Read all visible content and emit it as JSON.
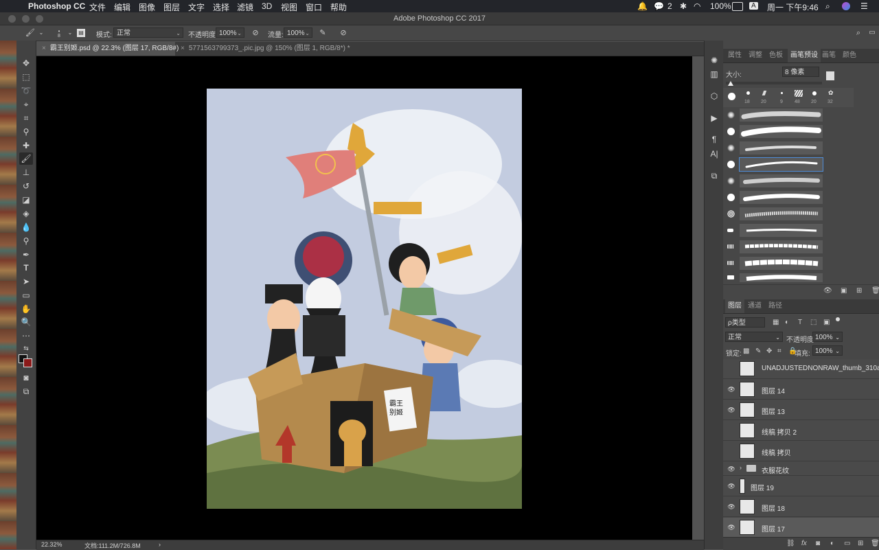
{
  "menubar": {
    "app_name": "Photoshop CC",
    "menus": [
      "文件",
      "编辑",
      "图像",
      "图层",
      "文字",
      "选择",
      "滤镜",
      "3D",
      "视图",
      "窗口",
      "帮助"
    ],
    "wechat_badge": "2",
    "battery": "100%",
    "input_method": "A",
    "clock": "周一 下午9:46"
  },
  "window": {
    "title": "Adobe Photoshop CC 2017"
  },
  "options": {
    "brush_size": "8",
    "mode_label": "模式:",
    "mode_value": "正常",
    "opacity_label": "不透明度:",
    "opacity_value": "100%",
    "flow_label": "流量:",
    "flow_value": "100%"
  },
  "doc_tabs": [
    {
      "label": "霸王别姬.psd @ 22.3% (图层 17, RGB/8#)",
      "active": true
    },
    {
      "label": "5771563799373_.pic.jpg @ 150% (图层 1, RGB/8*) *",
      "active": false
    }
  ],
  "status": {
    "zoom": "22.32%",
    "doc_info": "文档:111.2M/726.8M",
    "arrow": "›"
  },
  "panel_tabs_top": [
    "属性",
    "调整",
    "色板",
    "画笔预设",
    "画笔",
    "颜色"
  ],
  "brush_preset": {
    "size_label": "大小:",
    "size_value": "8 像素",
    "tip_sizes": [
      "",
      "18",
      "20",
      "9",
      "48",
      "20",
      "32"
    ]
  },
  "panel_tabs_layers": [
    "图层",
    "通道",
    "路径"
  ],
  "layers_panel": {
    "filter_kind": "ρ类型",
    "blend_mode": "正常",
    "opacity_label": "不透明度:",
    "opacity_value": "100%",
    "lock_label": "锁定:",
    "fill_label": "填充:",
    "fill_value": "100%",
    "layers": [
      {
        "name": "UNADJUSTEDNONRAW_thumb_310a",
        "visible": false,
        "selected": false
      },
      {
        "name": "图层 14",
        "visible": true,
        "selected": false
      },
      {
        "name": "图层 13",
        "visible": true,
        "selected": false
      },
      {
        "name": "线稿 拷贝 2",
        "visible": false,
        "selected": false
      },
      {
        "name": "线稿 拷贝",
        "visible": false,
        "selected": false
      },
      {
        "name": "衣服花纹",
        "visible": true,
        "selected": false,
        "group": true
      },
      {
        "name": "图层 19",
        "visible": true,
        "selected": false
      },
      {
        "name": "图层 18",
        "visible": true,
        "selected": false
      },
      {
        "name": "图层 17",
        "visible": true,
        "selected": true
      }
    ]
  },
  "artwork_text": {
    "sign_line1": "霸王",
    "sign_line2": "别姬"
  },
  "colors": {
    "canvas_bg": "#c3cce0",
    "grass": "#7b8c52",
    "box": "#b48a4d",
    "flag": "#e07f7a"
  }
}
